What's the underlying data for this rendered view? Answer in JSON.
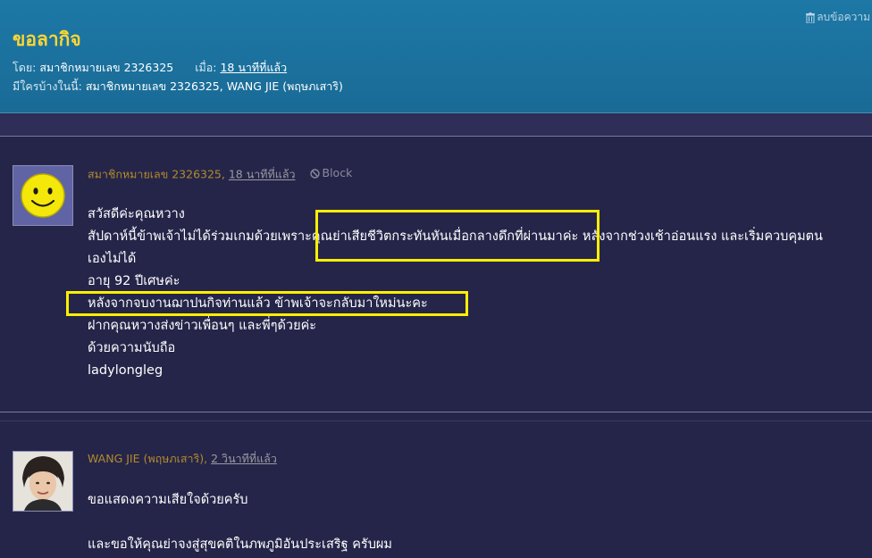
{
  "thread": {
    "delete_label": "ลบข้อความ",
    "title": "ขอลากิจ",
    "author_label": "โดย:",
    "author_name": "สมาชิกหมายเลข 2326325",
    "time_label": "เมื่อ:",
    "time_value": "18 นาทีที่แล้ว",
    "viewers_label": "มีใครบ้างในนี้:",
    "viewers_value": "สมาชิกหมายเลข 2326325, WANG JIE (พฤษภเสาริ)"
  },
  "posts": [
    {
      "author": "สมาชิกหมายเลข 2326325",
      "time": "18 นาทีที่แล้ว",
      "block_label": "Block",
      "avatar_icon": "smiley-icon",
      "lines": [
        "สวัสดีค่ะคุณหวาง",
        "สัปดาห์นี้ข้าพเจ้าไม่ได้ร่วมเกมด้วยเพราะคุณย่าเสียชีวิตกระทันหันเมื่อกลางดึกที่ผ่านมาค่ะ หลังจากช่วงเช้าอ่อนแรง และเริ่มควบคุมตน",
        "เองไม่ได้",
        "อายุ 92 ปีเศษค่ะ",
        "หลังจากจบงานฌาปนกิจท่านแล้ว ข้าพเจ้าจะกลับมาใหม่นะคะ",
        "ฝากคุณหวางส่งข่าวเพื่อนๆ และพี่ๆด้วยค่ะ",
        "ด้วยความนับถือ",
        "ladylongleg"
      ]
    },
    {
      "author": "WANG JIE (พฤษภเสาริ)",
      "time": "2 วินาทีที่แล้ว",
      "avatar_icon": "user-photo-avatar",
      "lines": [
        "ขอแสดงความเสียใจด้วยครับ",
        "",
        "และขอให้คุณย่าจงสู่สุขคติในภพภูมิอันประเสริฐ ครับผม"
      ]
    }
  ],
  "colors": {
    "header_bg": "#1b72a0",
    "page_bg": "#25254a",
    "title": "#ffd633",
    "author_name": "#b28b2a",
    "highlight": "#ffef00"
  }
}
